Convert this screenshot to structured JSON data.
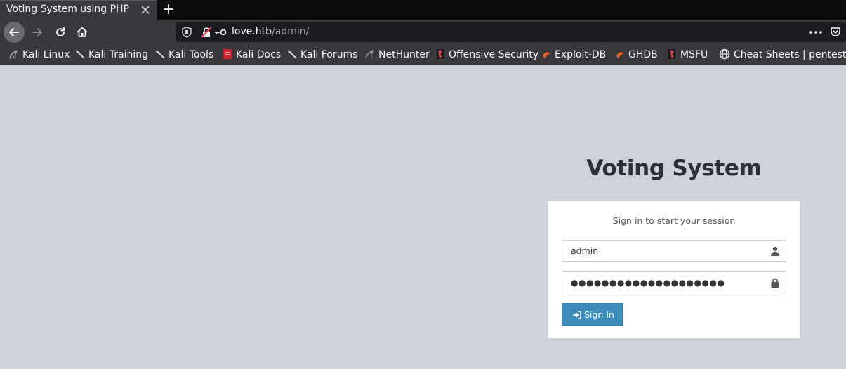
{
  "browser": {
    "tab_title": "Voting System using PHP",
    "url_host": "love.htb",
    "url_path": "/admin/",
    "bookmarks": [
      {
        "label": "Kali Linux",
        "icon": "kali-dragon-icon"
      },
      {
        "label": "Kali Training",
        "icon": "kali-dragon-icon"
      },
      {
        "label": "Kali Tools",
        "icon": "kali-dragon-icon"
      },
      {
        "label": "Kali Docs",
        "icon": "kali-docs-icon"
      },
      {
        "label": "Kali Forums",
        "icon": "kali-dragon-icon"
      },
      {
        "label": "NetHunter",
        "icon": "nethunter-icon"
      },
      {
        "label": "Offensive Security",
        "icon": "offsec-icon"
      },
      {
        "label": "Exploit-DB",
        "icon": "exploitdb-icon"
      },
      {
        "label": "GHDB",
        "icon": "ghdb-icon"
      },
      {
        "label": "MSFU",
        "icon": "msfu-icon"
      },
      {
        "label": "Cheat Sheets | pentest…",
        "icon": "globe-icon"
      }
    ]
  },
  "page": {
    "logo": "Voting System",
    "box_message": "Sign in to start your session",
    "username_value": "admin",
    "password_value": "●●●●●●●●●●●●●●●●●●●●",
    "signin_label": "Sign In"
  },
  "colors": {
    "page_bg": "#cdd1da",
    "button_primary": "#3c8dbc",
    "toolbar_bg": "#38383d"
  }
}
